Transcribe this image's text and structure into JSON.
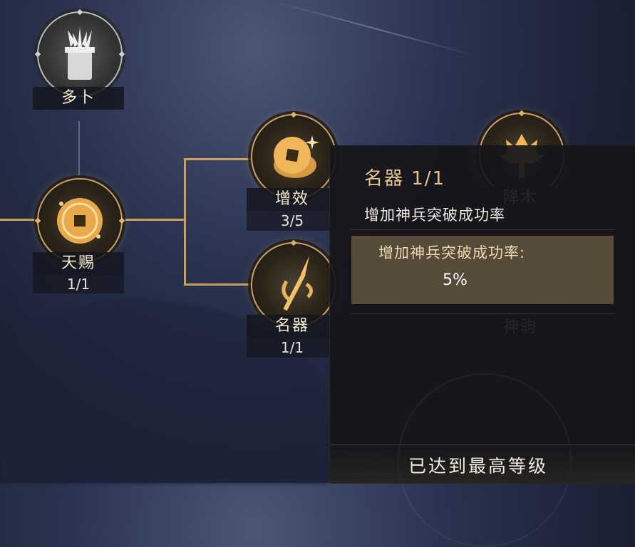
{
  "nodes": {
    "duobu": {
      "label": "多卜"
    },
    "tianci": {
      "label": "天赐",
      "count": "1/1"
    },
    "zengxiao": {
      "label": "增效",
      "count": "3/5"
    },
    "mingqi": {
      "label": "名器",
      "count": "1/1"
    },
    "jiangmu": {
      "label": "降木"
    },
    "shenju": {
      "label": "神驹"
    }
  },
  "tooltip": {
    "title": "名器  1/1",
    "description": "增加神兵突破成功率",
    "effect_label": "增加神兵突破成功率:",
    "effect_value": "5%",
    "footer": "已达到最高等级"
  },
  "colors": {
    "gold": "#caa05a",
    "title_gold": "#e6c489"
  }
}
